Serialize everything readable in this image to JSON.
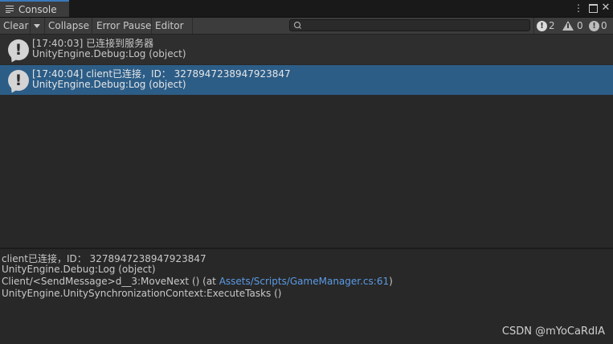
{
  "window": {
    "tab_title": "Console",
    "menu_icon": "vertical-ellipsis-icon",
    "maximize_icon": "maximize-icon",
    "close_icon": "close-icon"
  },
  "toolbar": {
    "clear_label": "Clear",
    "collapse_label": "Collapse",
    "error_pause_label": "Error Pause",
    "editor_label": "Editor",
    "search": {
      "value": "",
      "placeholder": ""
    },
    "info_count": "2",
    "warning_count": "0",
    "error_count": "0"
  },
  "logs": [
    {
      "line1": "[17:40:03] 已连接到服务器",
      "line2": "UnityEngine.Debug:Log (object)",
      "selected": false
    },
    {
      "line1": "[17:40:04] client已连接，ID： 3278947238947923847",
      "line2": "UnityEngine.Debug:Log (object)",
      "selected": true
    }
  ],
  "detail": {
    "line1": "client已连接，ID： 3278947238947923847",
    "line2": "UnityEngine.Debug:Log (object)",
    "line3_prefix": "Client/<SendMessage>d__3:MoveNext () (at ",
    "line3_link": "Assets/Scripts/GameManager.cs:61",
    "line3_suffix": ")",
    "line4": "UnityEngine.UnitySynchronizationContext:ExecuteTasks ()"
  },
  "watermark": "CSDN @mYoCaRdIA",
  "colors": {
    "selected_row": "#2c5d87",
    "link": "#5b9be6",
    "tab_accent": "#3a79bb"
  }
}
